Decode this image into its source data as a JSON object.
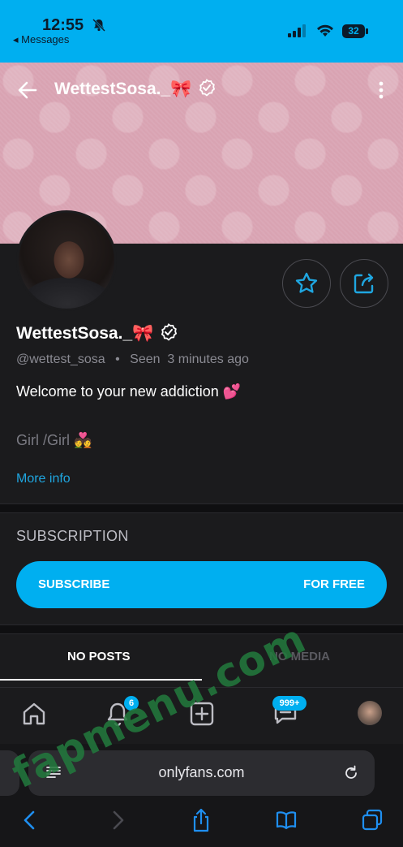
{
  "status_bar": {
    "time": "12:55",
    "back_app": "Messages",
    "battery": "32"
  },
  "header": {
    "title": "WettestSosa._🎀"
  },
  "profile": {
    "name": "WettestSosa._🎀",
    "handle": "@wettest_sosa",
    "separator": "•",
    "seen": "Seen  3 minutes ago",
    "bio_line1": "Welcome to your new addiction 💕",
    "bio_line2": "Girl /Girl 💑",
    "more_info": "More info"
  },
  "subscription": {
    "heading": "SUBSCRIPTION",
    "button_left": "SUBSCRIBE",
    "button_right": "FOR FREE"
  },
  "tabs": [
    {
      "label": "NO POSTS",
      "active": true
    },
    {
      "label": "NO MEDIA",
      "active": false
    }
  ],
  "bottom_nav": {
    "notifications_badge": "6",
    "messages_badge": "999+"
  },
  "browser": {
    "url": "onlyfans.com"
  },
  "watermark": "fapmenu.com",
  "colors": {
    "accent": "#00aff0",
    "background": "#1b1b1d",
    "link": "#1fa6e0"
  }
}
